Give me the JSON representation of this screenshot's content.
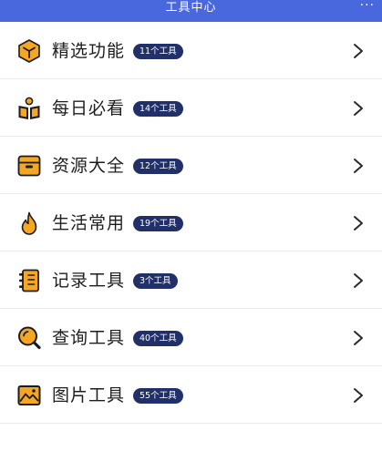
{
  "header": {
    "title": "工具中心",
    "more_label": "···"
  },
  "colors": {
    "header_bg": "#4a68de",
    "icon_orange": "#f5a623",
    "icon_dark": "#1c1c1c",
    "badge_bg": "#223069"
  },
  "items": [
    {
      "label": "精选功能",
      "badge": "11个工具",
      "icon": "cube-icon"
    },
    {
      "label": "每日必看",
      "badge": "14个工具",
      "icon": "open-book-icon"
    },
    {
      "label": "资源大全",
      "badge": "12个工具",
      "icon": "archive-box-icon"
    },
    {
      "label": "生活常用",
      "badge": "19个工具",
      "icon": "flame-icon"
    },
    {
      "label": "记录工具",
      "badge": "3个工具",
      "icon": "notebook-icon"
    },
    {
      "label": "查询工具",
      "badge": "40个工具",
      "icon": "magnifier-icon"
    },
    {
      "label": "图片工具",
      "badge": "55个工具",
      "icon": "picture-icon"
    }
  ]
}
